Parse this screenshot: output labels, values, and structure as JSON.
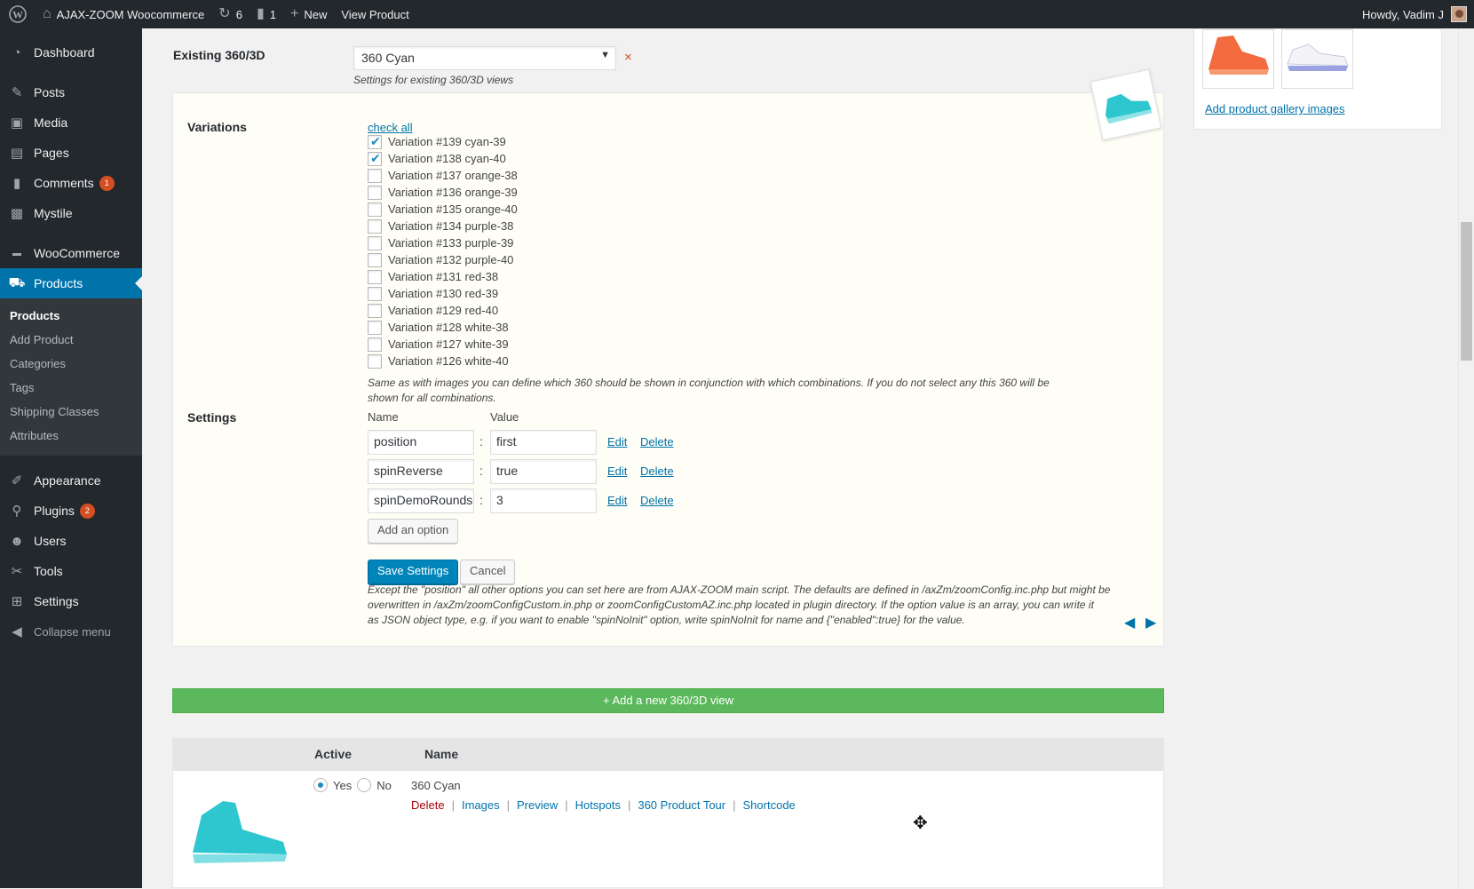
{
  "adminbar": {
    "site_name": "AJAX-ZOOM Woocommerce",
    "updates_count": "6",
    "comments_count": "1",
    "new_label": "New",
    "view_product_label": "View Product",
    "greeting": "Howdy, Vadim J"
  },
  "menu": {
    "dashboard": "Dashboard",
    "posts": "Posts",
    "media": "Media",
    "pages": "Pages",
    "comments": "Comments",
    "comments_badge": "1",
    "mystile": "Mystile",
    "woocommerce": "WooCommerce",
    "products": "Products",
    "sub": [
      "Products",
      "Add Product",
      "Categories",
      "Tags",
      "Shipping Classes",
      "Attributes"
    ],
    "appearance": "Appearance",
    "plugins": "Plugins",
    "plugins_badge": "2",
    "users": "Users",
    "tools": "Tools",
    "settings": "Settings",
    "collapse": "Collapse menu"
  },
  "existing": {
    "label": "Existing 360/3D",
    "selected": "360 Cyan",
    "remove": "×",
    "description": "Settings for existing 360/3D views"
  },
  "variations": {
    "label": "Variations",
    "check_all": "check all",
    "items": [
      {
        "label": "Variation #139 cyan-39",
        "checked": true
      },
      {
        "label": "Variation #138 cyan-40",
        "checked": true
      },
      {
        "label": "Variation #137 orange-38",
        "checked": false
      },
      {
        "label": "Variation #136 orange-39",
        "checked": false
      },
      {
        "label": "Variation #135 orange-40",
        "checked": false
      },
      {
        "label": "Variation #134 purple-38",
        "checked": false
      },
      {
        "label": "Variation #133 purple-39",
        "checked": false
      },
      {
        "label": "Variation #132 purple-40",
        "checked": false
      },
      {
        "label": "Variation #131 red-38",
        "checked": false
      },
      {
        "label": "Variation #130 red-39",
        "checked": false
      },
      {
        "label": "Variation #129 red-40",
        "checked": false
      },
      {
        "label": "Variation #128 white-38",
        "checked": false
      },
      {
        "label": "Variation #127 white-39",
        "checked": false
      },
      {
        "label": "Variation #126 white-40",
        "checked": false
      }
    ],
    "help_line1": "Same as with images you can define which 360 should be shown in conjunction with which combinations. If you do not select any this 360 will be",
    "help_line2": "shown for all combinations."
  },
  "settings": {
    "label": "Settings",
    "col_name": "Name",
    "col_value": "Value",
    "options": [
      {
        "name": "position",
        "value": "first"
      },
      {
        "name": "spinReverse",
        "value": "true"
      },
      {
        "name": "spinDemoRounds",
        "value": "3"
      }
    ],
    "edit": "Edit",
    "delete": "Delete",
    "add_option": "Add an option",
    "save": "Save Settings",
    "cancel": "Cancel",
    "help_line1": "Except the \"position\" all other options you can set here are from AJAX-ZOOM main script. The defaults are defined in /axZm/zoomConfig.inc.php but might be",
    "help_line2": "overwritten in /axZm/zoomConfigCustom.in.php or zoomConfigCustomAZ.inc.php located in plugin directory. If the option value is an array, you can write it",
    "help_line3": "as JSON object type, e.g. if you want to enable \"spinNoInit\" option, write spinNoInit for name and {\"enabled\":true} for the value."
  },
  "add_new_360": "+ Add a new 360/3D view",
  "table": {
    "col_active": "Active",
    "col_name": "Name",
    "row": {
      "yes": "Yes",
      "no": "No",
      "active": "yes",
      "name": "360 Cyan",
      "actions": [
        "Delete",
        "Images",
        "Preview",
        "Hotspots",
        "360 Product Tour",
        "Shortcode"
      ]
    }
  },
  "gallery": {
    "add_link": "Add product gallery images"
  },
  "colors": {
    "wp_blue": "#0073aa",
    "admin_dark": "#23282d",
    "green_bar": "#5cb85c",
    "cyan_shoe": "#2fc7cf",
    "orange_shoe": "#f26a3d"
  }
}
